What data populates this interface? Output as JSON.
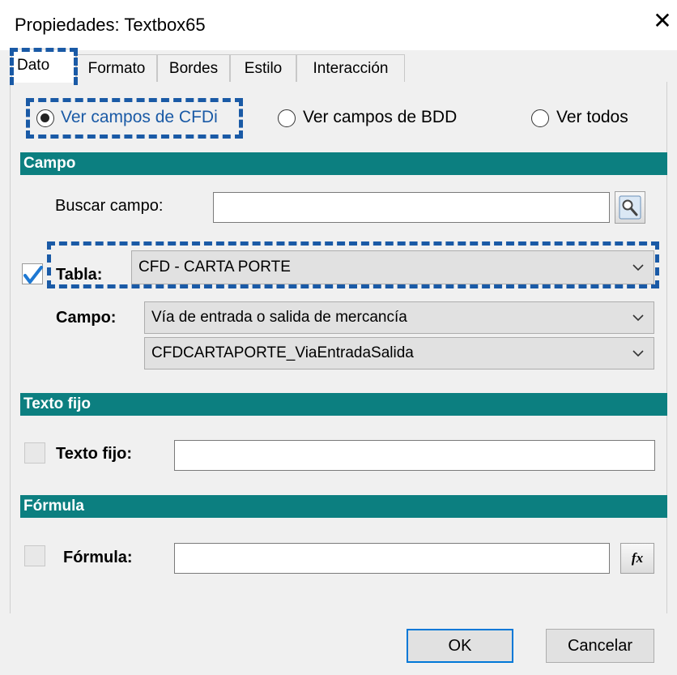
{
  "window": {
    "title": "Propiedades: Textbox65",
    "close_glyph": "✕"
  },
  "tabs": [
    {
      "label": "Dato",
      "active": true
    },
    {
      "label": "Formato"
    },
    {
      "label": "Bordes"
    },
    {
      "label": "Estilo"
    },
    {
      "label": "Interacción"
    }
  ],
  "view_options": [
    {
      "label": "Ver campos de CFDi",
      "selected": true
    },
    {
      "label": "Ver campos de BDD",
      "selected": false
    },
    {
      "label": "Ver todos",
      "selected": false
    }
  ],
  "campo_section": {
    "header": "Campo",
    "buscar_label": "Buscar campo:",
    "buscar_value": "",
    "tabla_label": "Tabla:",
    "tabla_checked": true,
    "tabla_value": "CFD - CARTA PORTE",
    "campo_label": "Campo:",
    "campo_value": "Vía de entrada o salida de mercancía",
    "campo_code_value": "CFDCARTAPORTE_ViaEntradaSalida"
  },
  "texto_fijo_section": {
    "header": "Texto fijo",
    "label": "Texto fijo:",
    "checked": false,
    "value": ""
  },
  "formula_section": {
    "header": "Fórmula",
    "label": "Fórmula:",
    "checked": false,
    "value": "",
    "fx_label": "fx"
  },
  "buttons": {
    "ok": "OK",
    "cancel": "Cancelar"
  },
  "colors": {
    "section_header": "#0c7f80",
    "highlight": "#1a5aa6",
    "default_button_border": "#0078d7",
    "check_mark": "#1e78d2"
  }
}
